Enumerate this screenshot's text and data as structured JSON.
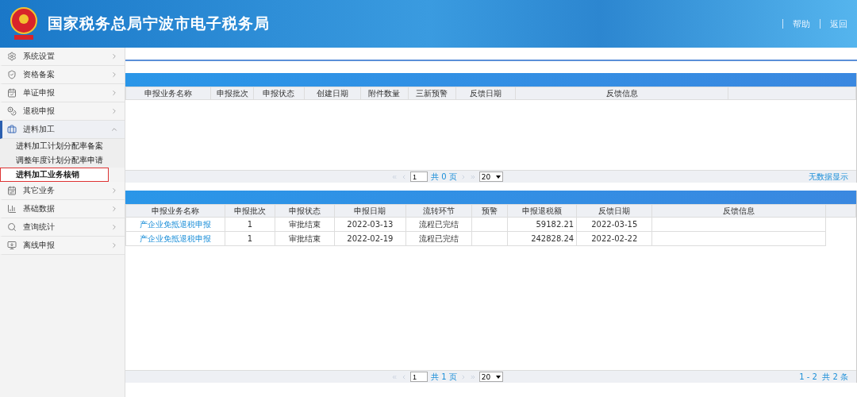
{
  "header": {
    "title": "国家税务总局宁波市电子税务局",
    "links": [
      "帮助",
      "返回"
    ]
  },
  "sidebar": {
    "items": [
      {
        "label": "系统设置",
        "expanded": false,
        "selected": false
      },
      {
        "label": "资格备案",
        "expanded": false,
        "selected": false
      },
      {
        "label": "单证申报",
        "expanded": false,
        "selected": false
      },
      {
        "label": "退税申报",
        "expanded": false,
        "selected": false
      },
      {
        "label": "进料加工",
        "expanded": true,
        "selected": true,
        "children": [
          {
            "label": "进料加工计划分配率备案",
            "selected": false
          },
          {
            "label": "调整年度计划分配率申请",
            "selected": false
          },
          {
            "label": "进料加工业务核销",
            "selected": true
          }
        ]
      },
      {
        "label": "其它业务",
        "expanded": false,
        "selected": false
      },
      {
        "label": "基础数据",
        "expanded": false,
        "selected": false
      },
      {
        "label": "查询统计",
        "expanded": false,
        "selected": false
      },
      {
        "label": "离线申报",
        "expanded": false,
        "selected": false
      }
    ]
  },
  "panels": [
    {
      "columns": [
        "申报业务名称",
        "申报批次",
        "申报状态",
        "创建日期",
        "附件数量",
        "三新预警",
        "反馈日期",
        "反馈信息"
      ],
      "pager": {
        "page": "1",
        "total_pages": "共 0 页",
        "page_size": "20",
        "summary": "无数据显示"
      }
    },
    {
      "columns": [
        "申报业务名称",
        "申报批次",
        "申报状态",
        "申报日期",
        "流转环节",
        "预警",
        "申报退税额",
        "反馈日期",
        "反馈信息"
      ],
      "rows": [
        [
          "产企业免抵退税申报",
          "1",
          "审批结束",
          "2022-03-13",
          "流程已完结",
          "",
          "59182.21",
          "2022-03-15",
          ""
        ],
        [
          "产企业免抵退税申报",
          "1",
          "审批结束",
          "2022-02-19",
          "流程已完结",
          "",
          "242828.24",
          "2022-02-22",
          ""
        ]
      ],
      "pager": {
        "page": "1",
        "total_pages": "共 1 页",
        "page_size": "20",
        "summary": "1 - 2  共 2 条"
      }
    }
  ]
}
